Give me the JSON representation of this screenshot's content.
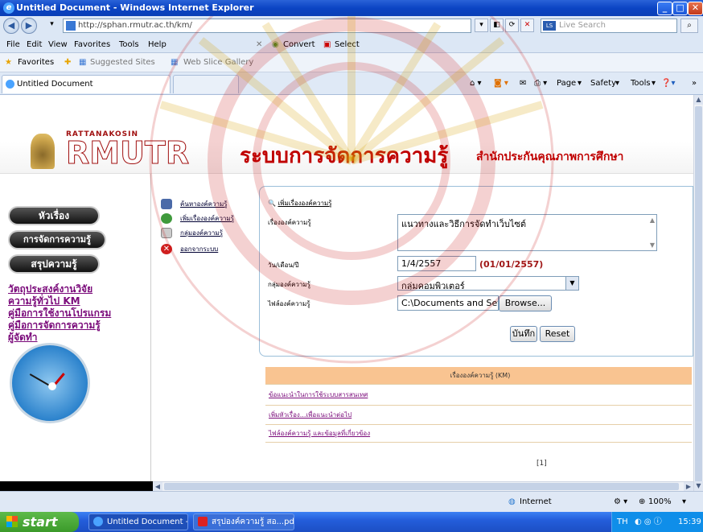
{
  "window": {
    "title": "Untitled Document - Windows Internet Explorer"
  },
  "browser": {
    "url": "http://sphan.rmutr.ac.th/km/",
    "search_placeholder": "Live Search",
    "menu": [
      "File",
      "Edit",
      "View",
      "Favorites",
      "Tools",
      "Help"
    ],
    "toolbar_extras": [
      "Convert",
      "Select"
    ],
    "favorites_bar": {
      "favorites_label": "Favorites",
      "items": [
        "Suggested Sites",
        "Web Slice Gallery"
      ]
    },
    "tab_title": "Untitled Document",
    "commands": [
      "Page",
      "Safety",
      "Tools"
    ]
  },
  "site": {
    "logo_small": "RATTANAKOSIN",
    "logo_big": "RMUTR",
    "title": "ระบบการจัดการความรู้",
    "subtitle": "สำนักประกันคุณภาพการศึกษา"
  },
  "left_nav": {
    "pills": [
      "หัวเรื่อง",
      "การจัดการความรู้",
      "สรุปความรู้"
    ],
    "links": [
      "วัตถุประสงค์งานวิจัย",
      "ความรู้ทั่วไป KM",
      "คู่มือการใช้งานโปรแกรม",
      "คู่มือการจัดการความรู้",
      "ผู้จัดทำ"
    ]
  },
  "mid_menu": {
    "items": [
      "ค้นหาองค์ความรู้",
      "เพิ่มเรื่ององค์ความรู้",
      "กลุ่มองค์ความรู้",
      "ออกจากระบบ"
    ]
  },
  "form": {
    "header": "เพิ่มเรื่ององค์ความรู้",
    "labels": {
      "title": "เรื่ององค์ความรู้",
      "date": "วัน/เดือน/ปี",
      "group": "กลุ่มองค์ความรู้",
      "file": "ไฟล์องค์ความรู้"
    },
    "title_value": "แนวทางและวิธีการจัดทำเว็บไซต์",
    "date_value": "1/4/2557",
    "date_hint": "(01/01/2557)",
    "group_value": "กลุ่มคอมพิวเตอร์",
    "file_value": "C:\\Documents and Setti",
    "browse_label": "Browse...",
    "save_label": "บันทึก",
    "reset_label": "Reset"
  },
  "table": {
    "header": "เรื่ององค์ความรู้ (KM)",
    "rows": [
      "ข้อแนะนำในการใช้ระบบสารสนเทศ",
      "เพิ่มหัวเรื่อง...เพื่อแนะนำต่อไป",
      "ไฟล์องค์ความรู้ และข้อมูลที่เกี่ยวข้อง"
    ],
    "pager": "[1]"
  },
  "status": {
    "zone": "Internet",
    "zoom": "100%"
  },
  "taskbar": {
    "start": "start",
    "tasks": [
      "Untitled Document - ...",
      "สรุปองค์ความรู้ สอ...pd..."
    ],
    "lang": "TH",
    "time": "15:39"
  }
}
